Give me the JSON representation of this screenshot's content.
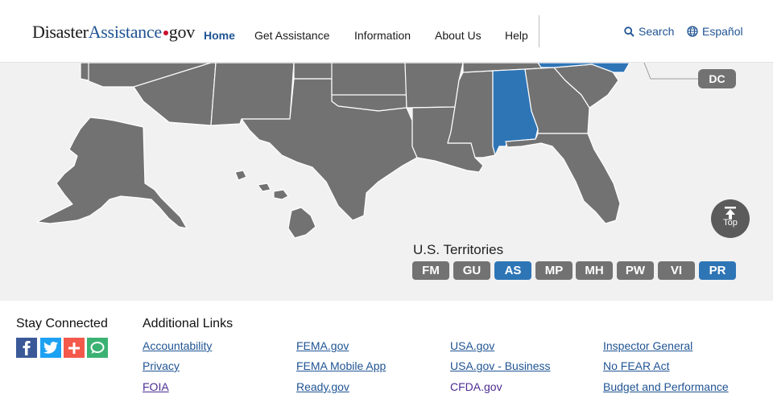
{
  "header": {
    "logo": {
      "part1": "Disaster",
      "part2": "Assistance",
      "part3": "gov"
    },
    "nav": [
      {
        "label": "Home",
        "active": true
      },
      {
        "label": "Get Assistance"
      },
      {
        "label": "Information"
      },
      {
        "label": "About Us"
      },
      {
        "label": "Help"
      }
    ],
    "search_label": "Search",
    "language_label": "Español"
  },
  "map": {
    "highlight_color": "#2e75b6",
    "state_color": "#727272",
    "highlighted_states": [
      "AL",
      "NC",
      "VA"
    ],
    "dc_label": "DC",
    "top_label": "Top",
    "territories_title": "U.S. Territories",
    "territories": [
      {
        "code": "FM",
        "active": false
      },
      {
        "code": "GU",
        "active": false
      },
      {
        "code": "AS",
        "active": true
      },
      {
        "code": "MP",
        "active": false
      },
      {
        "code": "MH",
        "active": false
      },
      {
        "code": "PW",
        "active": false
      },
      {
        "code": "VI",
        "active": false
      },
      {
        "code": "PR",
        "active": true
      }
    ]
  },
  "footer": {
    "stay_connected": "Stay Connected",
    "social": [
      "facebook-icon",
      "twitter-icon",
      "addthis-icon",
      "chat-icon"
    ],
    "additional_links_title": "Additional Links",
    "links": [
      [
        "Accountability",
        "Privacy",
        "FOIA"
      ],
      [
        "FEMA.gov",
        "FEMA Mobile App",
        "Ready.gov"
      ],
      [
        "USA.gov",
        "USA.gov - Business",
        "CFDA.gov"
      ],
      [
        "Inspector General",
        "No FEAR Act",
        "Budget and Performance"
      ]
    ]
  }
}
